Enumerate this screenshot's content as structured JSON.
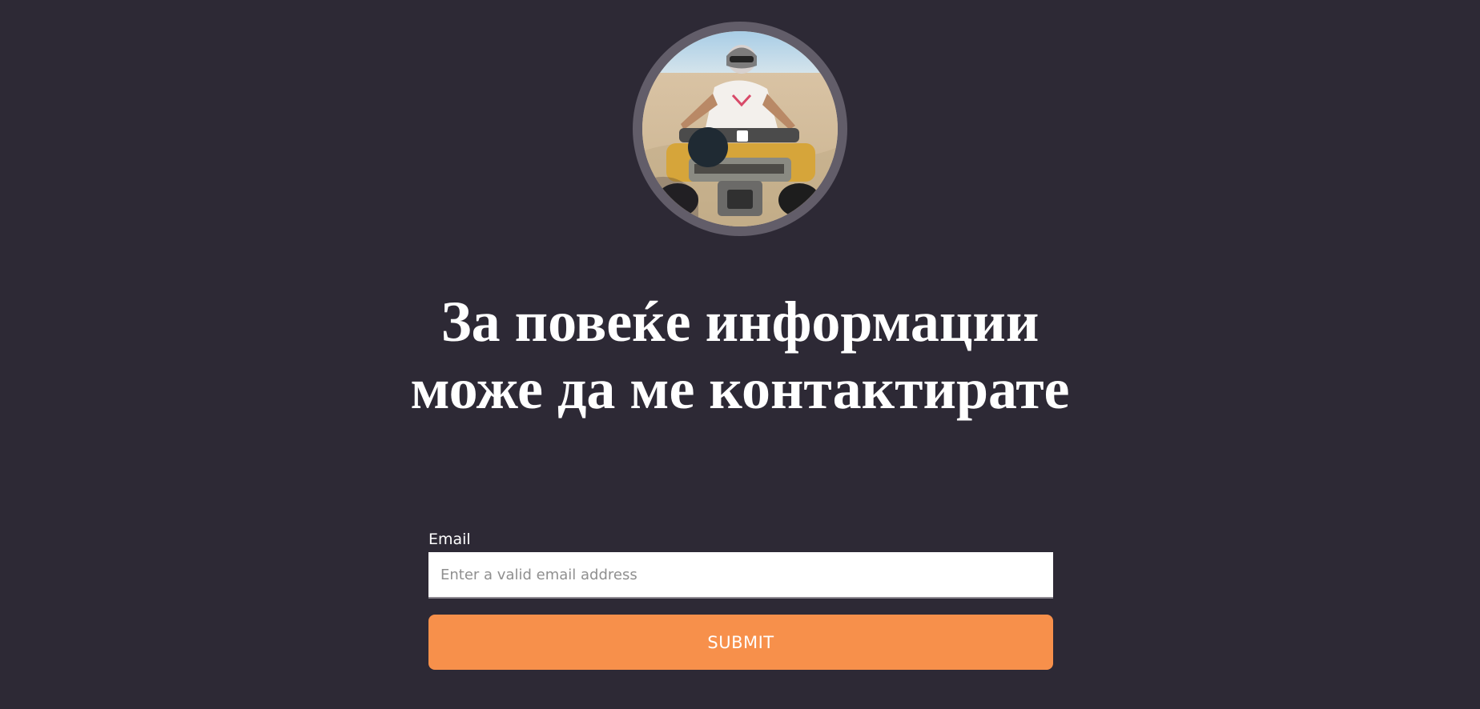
{
  "profile": {
    "avatar_alt": "profile photo"
  },
  "hero": {
    "heading_line1": "За повеќе информации",
    "heading_line2": "може да ме контактирате"
  },
  "form": {
    "email_label": "Email",
    "email_placeholder": "Enter a valid email address",
    "email_value": "",
    "submit_label": "SUBMIT"
  },
  "colors": {
    "background": "#2d2935",
    "avatar_ring": "#625d69",
    "button": "#f7904b",
    "text": "#ffffff"
  }
}
